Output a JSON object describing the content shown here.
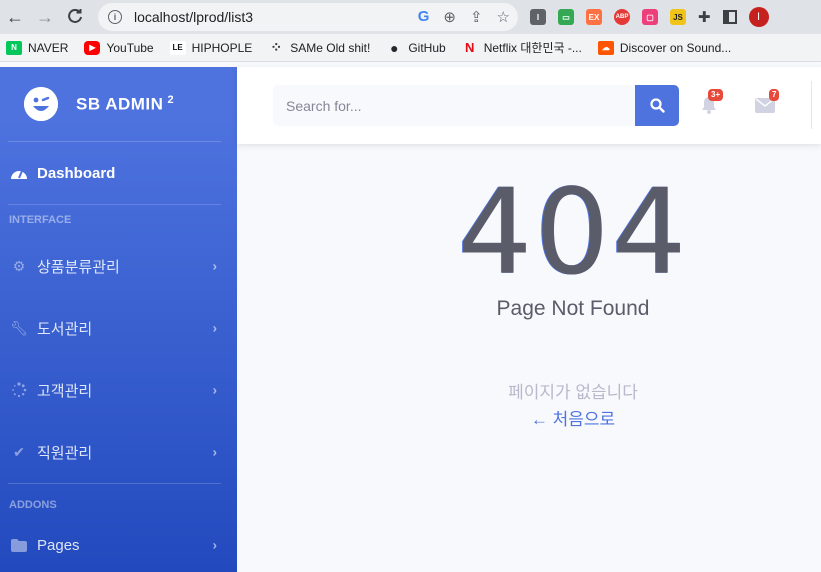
{
  "browser": {
    "url": "localhost/lprod/list3",
    "bookmarks": [
      {
        "label": "NAVER",
        "icon": "N",
        "color": "#03c75a"
      },
      {
        "label": "YouTube",
        "icon": "▶",
        "color": "#ff0000"
      },
      {
        "label": "HIPHOPLE",
        "icon": "LE",
        "color": "#111111"
      },
      {
        "label": "SAMe Old shit!",
        "icon": "⁘",
        "color": "#333333"
      },
      {
        "label": "GitHub",
        "icon": "●",
        "color": "#24292f"
      },
      {
        "label": "Netflix 대한민국 -...",
        "icon": "N",
        "color": "#e50914"
      },
      {
        "label": "Discover on Sound...",
        "icon": "☁",
        "color": "#ff5500"
      }
    ],
    "extensions": [
      {
        "text": "I",
        "color": "#5f6368"
      },
      {
        "text": "▭",
        "color": "#34a853"
      },
      {
        "text": "EX",
        "color": "#ff7043"
      },
      {
        "text": "ABP",
        "color": "#e53935"
      },
      {
        "text": "▢",
        "color": "#ec407a"
      },
      {
        "text": "JS",
        "color": "#f0c419"
      }
    ],
    "profile_initial": "I"
  },
  "brand": {
    "name": "SB ADMIN",
    "sup": "2"
  },
  "sidebar": {
    "dashboard": "Dashboard",
    "heading_interface": "INTERFACE",
    "items": [
      {
        "label": "상품분류관리",
        "icon": "gear-icon"
      },
      {
        "label": "도서관리",
        "icon": "wrench-icon"
      },
      {
        "label": "고객관리",
        "icon": "spinner-icon"
      },
      {
        "label": "직원관리",
        "icon": "check-icon"
      }
    ],
    "heading_addons": "ADDONS",
    "pages": "Pages"
  },
  "topbar": {
    "search_placeholder": "Search for...",
    "alerts_badge": "3+",
    "messages_badge": "7"
  },
  "main": {
    "code": "404",
    "title": "Page Not Found",
    "message": "페이지가 없습니다",
    "back_link": "← 처음으로"
  },
  "colors": {
    "primary": "#4e73df",
    "danger": "#e74a3b",
    "text": "#5a5c69"
  }
}
